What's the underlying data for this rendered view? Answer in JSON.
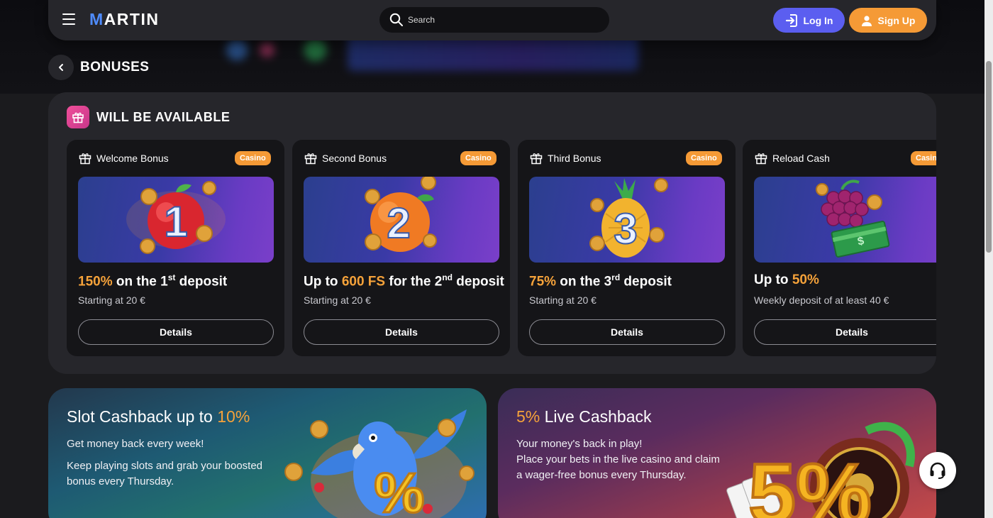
{
  "header": {
    "logo_first_letter": "M",
    "logo_rest": "ARTIN",
    "search_placeholder": "Search",
    "login_label": "Log In",
    "signup_label": "Sign Up"
  },
  "page": {
    "title": "BONUSES"
  },
  "section": {
    "title": "WILL BE AVAILABLE",
    "cards": [
      {
        "name": "Welcome Bonus",
        "tag": "Casino",
        "art_number": "1",
        "art_fruit": "apple",
        "headline_highlight": "150%",
        "headline_text": " on the 1",
        "headline_sup": "st",
        "headline_tail": " deposit",
        "sub": "Starting at 20 €",
        "button": "Details"
      },
      {
        "name": "Second Bonus",
        "tag": "Casino",
        "art_number": "2",
        "art_fruit": "orange",
        "headline_pre": "Up to ",
        "headline_highlight": "600 FS",
        "headline_text": " for the 2",
        "headline_sup": "nd",
        "headline_tail": " deposit",
        "sub": "Starting at 20 €",
        "button": "Details"
      },
      {
        "name": "Third Bonus",
        "tag": "Casino",
        "art_number": "3",
        "art_fruit": "pineapple",
        "headline_highlight": "75%",
        "headline_text": " on the 3",
        "headline_sup": "rd",
        "headline_tail": " deposit",
        "sub": "Starting at 20 €",
        "button": "Details"
      },
      {
        "name": "Reload Cash",
        "tag": "Casino",
        "art_fruit": "grapes",
        "headline_pre": "Up to ",
        "headline_highlight": "50%",
        "sub": "Weekly deposit of at least 40 €",
        "button": "Details"
      }
    ]
  },
  "banners": {
    "slot": {
      "title_pre": "Slot Cashback up to ",
      "title_highlight": "10%",
      "line1": "Get money back every week!",
      "line2": "Keep playing slots and grab your boosted bonus every Thursday."
    },
    "live": {
      "title_highlight": "5%",
      "title_post": " Live Cashback",
      "line1": "Your money's back in play!",
      "line2": "Place your bets in the live casino and claim a wager-free bonus every Thursday."
    }
  },
  "colors": {
    "accent_orange": "#f5a23a",
    "login_blue": "#5b5ef0",
    "signup_orange": "#f59a36",
    "gift_pink": "#f04f9a"
  },
  "icons": [
    "menu-icon",
    "search-icon",
    "login-arrow-icon",
    "user-icon",
    "chevron-left-icon",
    "gift-icon",
    "support-headset-icon"
  ]
}
